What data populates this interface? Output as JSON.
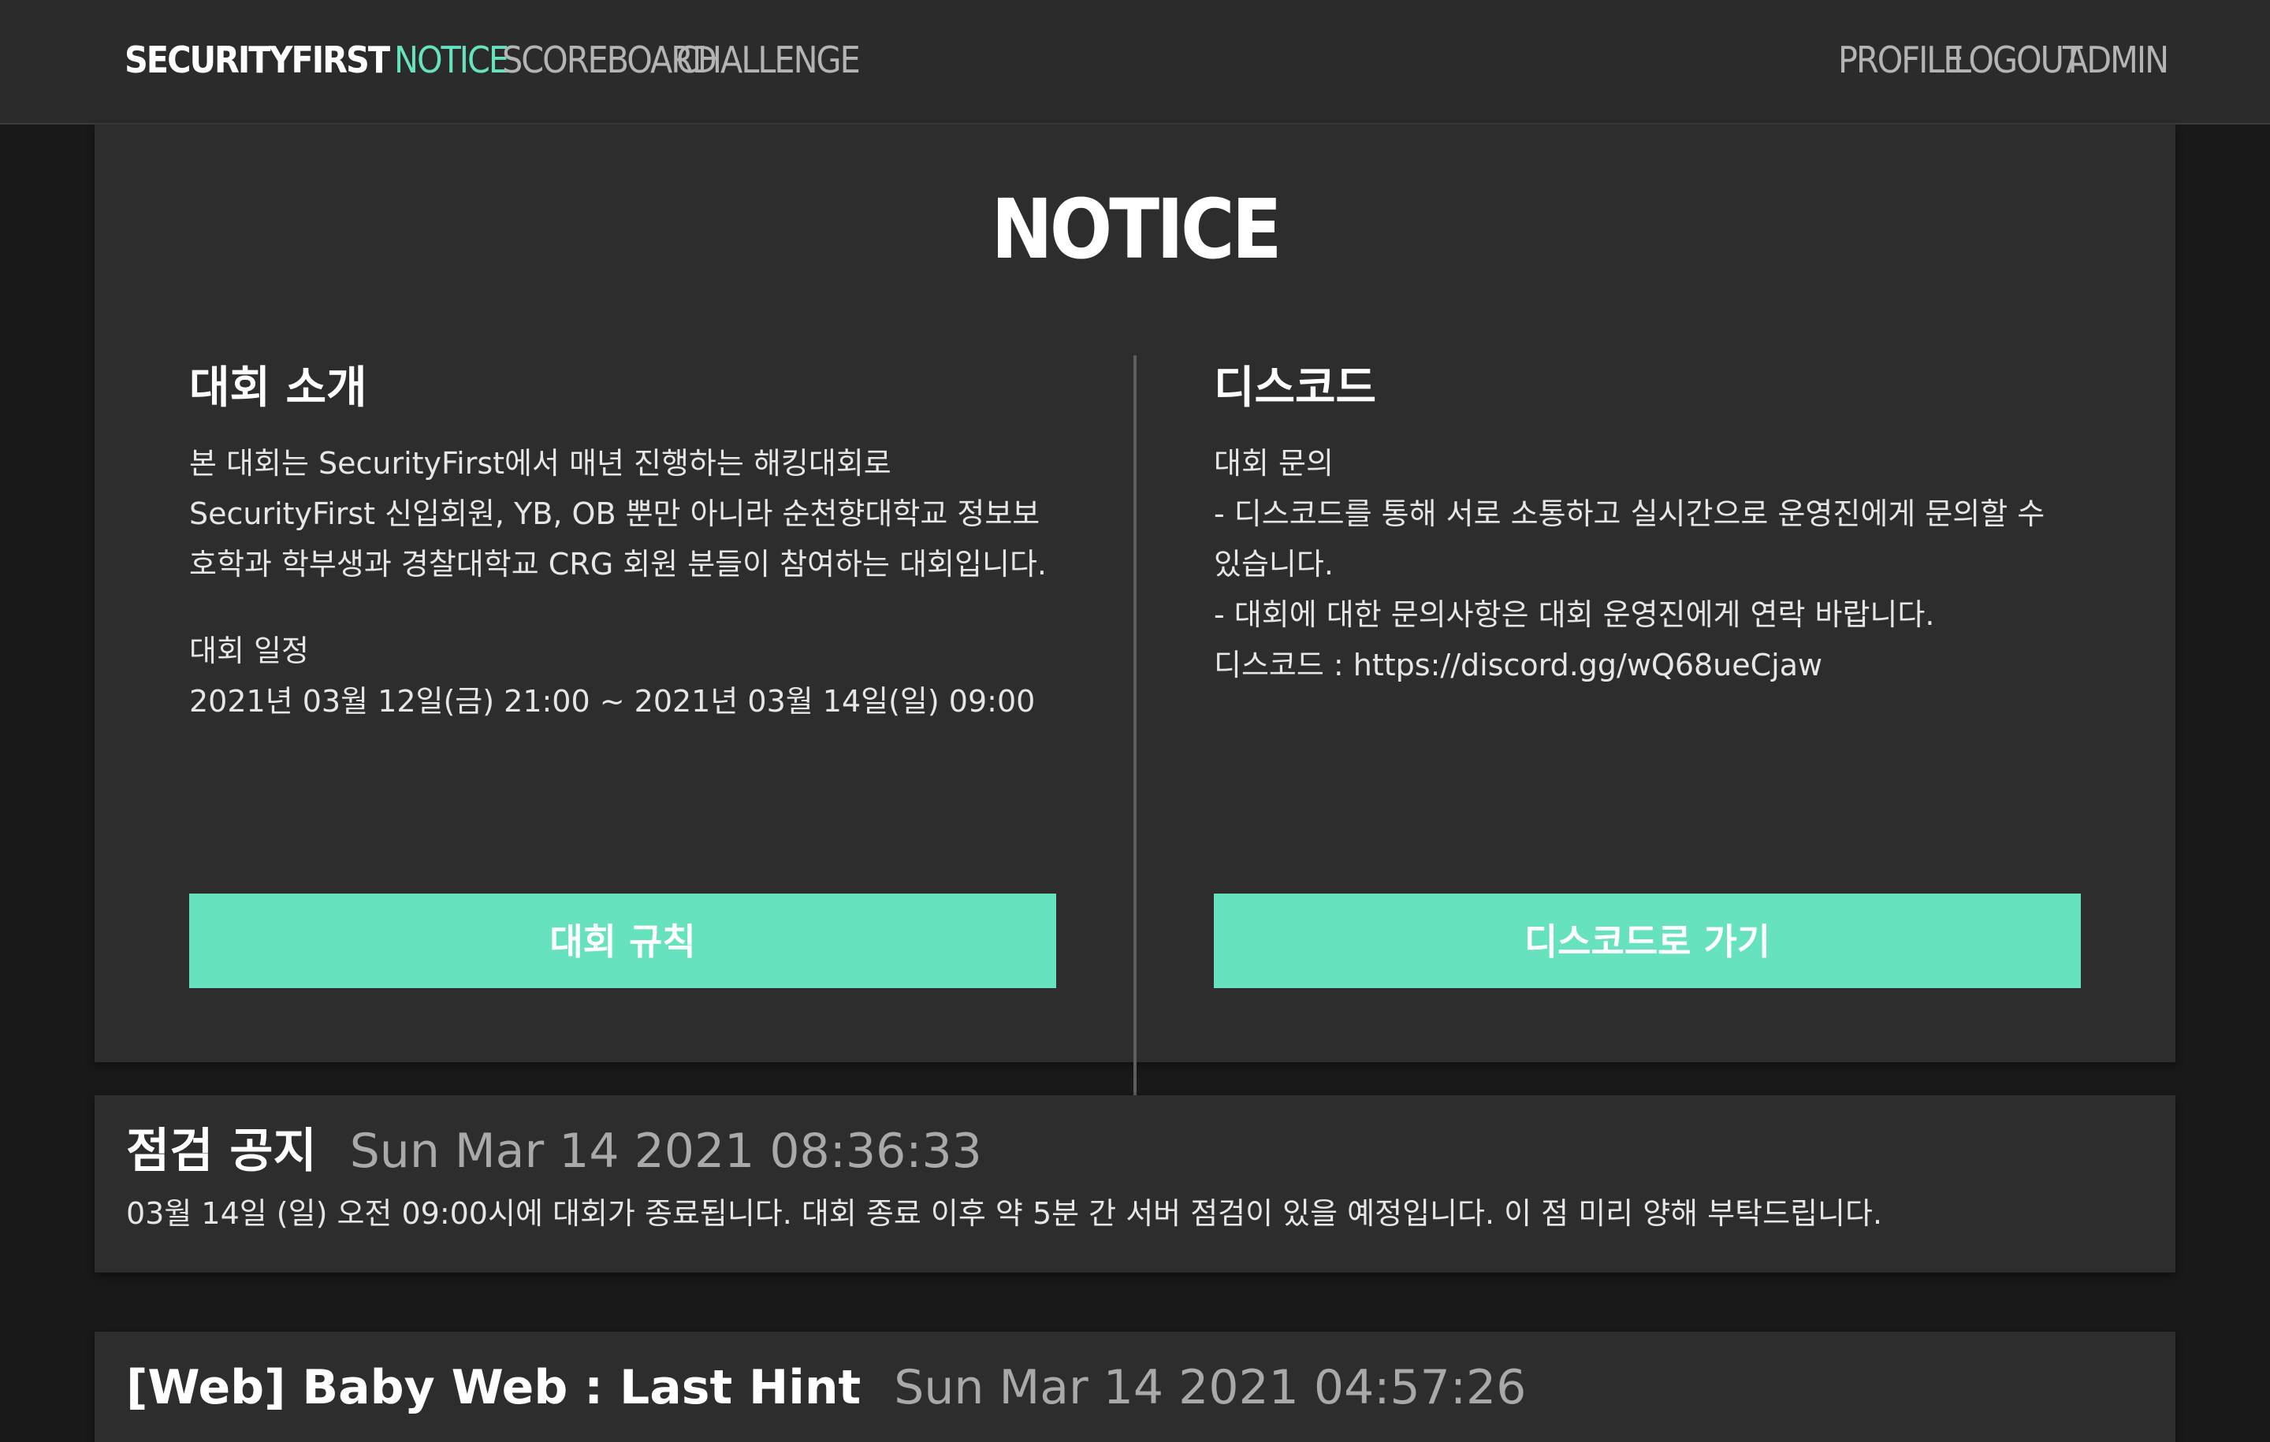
{
  "nav": {
    "brand": "SECURITYFIRST",
    "links": [
      "NOTICE",
      "SCOREBOARD",
      "CHALLENGE"
    ],
    "active": "NOTICE",
    "right_links": [
      "PROFILE",
      "LOGOUT",
      "ADMIN"
    ]
  },
  "hero": {
    "title": "NOTICE",
    "left": {
      "heading": "대회 소개",
      "intro": "본 대회는 SecurityFirst에서 매년 진행하는 해킹대회로 SecurityFirst 신입회원, YB, OB 뿐만 아니라 순천향대학교 정보보호학과 학부생과 경찰대학교 CRG 회원 분들이 참여하는 대회입니다.",
      "schedule_label": "대회 일정",
      "schedule": "2021년 03월 12일(금) 21:00 ~ 2021년 03월 14일(일) 09:00",
      "button": "대회 규칙"
    },
    "right": {
      "heading": "디스코드",
      "lines": [
        "대회 문의",
        "- 디스코드를 통해 서로 소통하고 실시간으로 운영진에게 문의할 수 있습니다.",
        "- 대회에 대한 문의사항은 대회 운영진에게 연락 바랍니다.",
        "디스코드 : https://discord.gg/wQ68ueCjaw"
      ],
      "button": "디스코드로 가기"
    }
  },
  "posts": [
    {
      "title": "점검 공지",
      "date": "Sun Mar 14 2021 08:36:33",
      "body": "03월 14일 (일) 오전 09:00시에 대회가 종료됩니다. 대회 종료 이후 약 5분 간 서버 점검이 있을 예정입니다. 이 점 미리 양해 부탁드립니다."
    },
    {
      "title": "[Web] Baby Web : Last Hint",
      "date": "Sun Mar 14 2021 04:57:26",
      "body": ""
    }
  ],
  "colors": {
    "accent": "#66e2be",
    "page_bg": "#191919",
    "card_bg": "#2d2d2d",
    "navbar_bg": "#2b2b2b",
    "muted_text": "#a9a9a9"
  }
}
